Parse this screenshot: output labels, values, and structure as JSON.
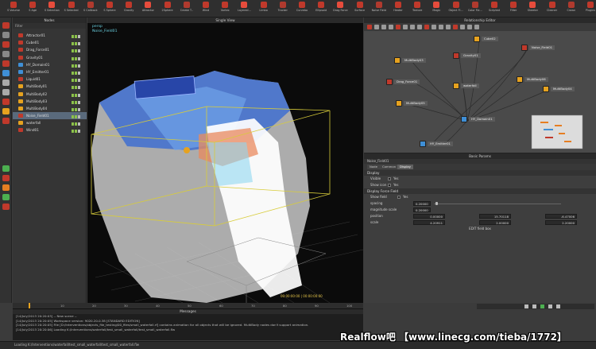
{
  "shelf": {
    "items": [
      "S Volume",
      "S Age",
      "S Selection",
      "S Selected",
      "S Callback",
      "S Sphere",
      "Gravity",
      "Attractor",
      "2Sphere",
      "Create T..",
      "Wind",
      "Vortex",
      "Layered...",
      "Limbo",
      "Tracker",
      "Curvebo",
      "Ellipsoid",
      "Drag Force",
      "Surface",
      "Noise Field",
      "Heater",
      "Texture",
      "Magic",
      "Object Fl...",
      "Color Fie...",
      "Scripted",
      "Filter",
      "Sheeter",
      "Cleaner",
      "Crown",
      "Plugins"
    ]
  },
  "nodes": {
    "title": "Nodes",
    "filter_label": "Filter",
    "items": [
      {
        "label": "Attractor01",
        "color": "#c0392b"
      },
      {
        "label": "Cube01",
        "color": "#c0392b"
      },
      {
        "label": "Drag_Force01",
        "color": "#c0392b"
      },
      {
        "label": "Gravity01",
        "color": "#c0392b"
      },
      {
        "label": "HY_Domain01",
        "color": "#3f8fd6"
      },
      {
        "label": "HY_Emitter01",
        "color": "#3f8fd6"
      },
      {
        "label": "Liquid01",
        "color": "#c0392b"
      },
      {
        "label": "MultiBody01",
        "color": "#e6a21f"
      },
      {
        "label": "MultiBody02",
        "color": "#e6a21f"
      },
      {
        "label": "MultiBody03",
        "color": "#e6a21f"
      },
      {
        "label": "MultiBody04",
        "color": "#e6a21f"
      },
      {
        "label": "Noise_Field01",
        "color": "#c0392b"
      },
      {
        "label": "waterfall",
        "color": "#e6a21f"
      },
      {
        "label": "Wind01",
        "color": "#c0392b"
      }
    ]
  },
  "viewport": {
    "title": "Single View",
    "label1": "persp",
    "label2": "Noise_Field01",
    "frame_readout": "00:00:00:00 | 00:00:00:00"
  },
  "relationship": {
    "title": "Relationship Editor",
    "nodes": [
      {
        "label": "Cube02",
        "color": "#e6a21f"
      },
      {
        "label": "Noise_Field01",
        "color": "#c0392b"
      },
      {
        "label": "MultiBody03",
        "color": "#e6a21f"
      },
      {
        "label": "Gravity01",
        "color": "#c0392b"
      },
      {
        "label": "Drag_Force01",
        "color": "#c0392b"
      },
      {
        "label": "waterfall",
        "color": "#e6a21f"
      },
      {
        "label": "MultiBody06",
        "color": "#e6a21f"
      },
      {
        "label": "MultiBody04",
        "color": "#e6a21f"
      },
      {
        "label": "MultiBody05",
        "color": "#e6a21f"
      },
      {
        "label": "HY_Domain01",
        "color": "#3f8fd6"
      },
      {
        "label": "HY_Emitter01",
        "color": "#3f8fd6"
      }
    ]
  },
  "basic_params": {
    "title": "Basic Params",
    "node_name": "Noise_Field01",
    "tabs": [
      "Node",
      "Common",
      "Display"
    ],
    "display_section": "Display",
    "visible_label": "Visible",
    "visible_value": "Yes",
    "show_icon_label": "Show icon",
    "show_icon_value": "Yes",
    "force_section": "Display Force Field",
    "show_field_label": "Show field",
    "show_field_value": "Yes",
    "spacing_label": "spacing",
    "spacing_value": "0.20000",
    "magnitude_label": "magnitude scale",
    "magnitude_value": "0.20000",
    "position_label": "position",
    "position_x": "0.00000",
    "position_y": "15.70118",
    "position_z": "-6.47006",
    "scale_label": "scale",
    "scale_x": "4.20911",
    "scale_y": "2.00000",
    "scale_z": "2.20000",
    "edit_button": "EDIT field box"
  },
  "timeline": {
    "ticks": [
      "0",
      "10",
      "20",
      "30",
      "40",
      "50",
      "60",
      "70",
      "80",
      "90",
      "100"
    ]
  },
  "console": {
    "title": "Messages",
    "lines": [
      "[14/July/2013 20:20:03] -- New scene --",
      "[14/July/2013 20:20:05] Workspace version: 9020.20.0.38 [STANDARD EDITION]",
      "[14/July/2013 20:20:05] File [D:/Interventions/objects_file_testing/00_files/small_waterfall.rf] contains animation for all objects that will be ignored. MultiBody nodes don't support animation.",
      "[14/July/2013 20:20:06] Loading K:/Interventions/waterfall/test_small_waterfall/test_small_waterfall.flw"
    ]
  },
  "status": {
    "text": "Loading K:/Interventions/waterfall/test_small_waterfall/test_small_waterfall.flw"
  },
  "watermark": {
    "text": "Realflow吧 【www.linecg.com/tieba/1772】"
  }
}
